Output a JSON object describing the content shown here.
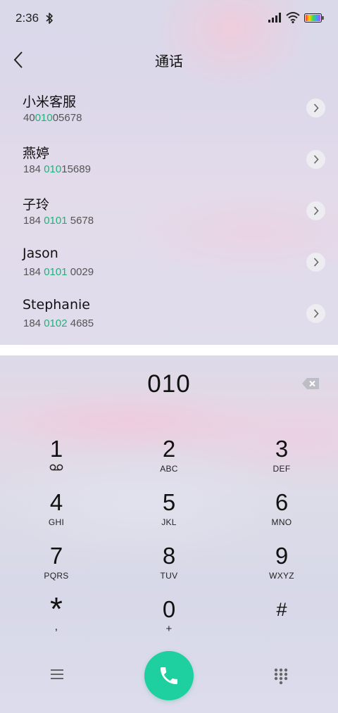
{
  "status_bar": {
    "time": "2:36",
    "icons": [
      "bluetooth-icon",
      "signal-icon",
      "wifi-icon",
      "battery-icon"
    ]
  },
  "header": {
    "back_icon": "chevron-left-icon",
    "title": "通话"
  },
  "contacts": [
    {
      "name": "小米客服",
      "number_pre": "40",
      "number_match": "010",
      "number_post": "05678"
    },
    {
      "name": "燕婷",
      "number_pre": "184 ",
      "number_match": "010",
      "number_post": "15689"
    },
    {
      "name": "子玲",
      "number_pre": "184 ",
      "number_match": "0101",
      "number_post": " 5678"
    },
    {
      "name": "Jason",
      "number_pre": "184 ",
      "number_match": "0101",
      "number_post": " 0029"
    },
    {
      "name": "Stephanie",
      "number_pre": "184 ",
      "number_match": "0102",
      "number_post": " 4685"
    }
  ],
  "dialer": {
    "input": "010",
    "backspace_icon": "backspace-icon"
  },
  "keypad": [
    {
      "digit": "1",
      "letters": ""
    },
    {
      "digit": "2",
      "letters": "ABC"
    },
    {
      "digit": "3",
      "letters": "DEF"
    },
    {
      "digit": "4",
      "letters": "GHI"
    },
    {
      "digit": "5",
      "letters": "JKL"
    },
    {
      "digit": "6",
      "letters": "MNO"
    },
    {
      "digit": "7",
      "letters": "PQRS"
    },
    {
      "digit": "8",
      "letters": "TUV"
    },
    {
      "digit": "9",
      "letters": "WXYZ"
    },
    {
      "digit": "*",
      "letters": ","
    },
    {
      "digit": "0",
      "letters": "+"
    },
    {
      "digit": "#",
      "letters": ""
    }
  ],
  "bottom_bar": {
    "menu_icon": "menu-icon",
    "call_icon": "phone-icon",
    "keypad_icon": "dialpad-icon"
  },
  "colors": {
    "accent": "#1db37a",
    "call_button": "#1ed0a0"
  }
}
